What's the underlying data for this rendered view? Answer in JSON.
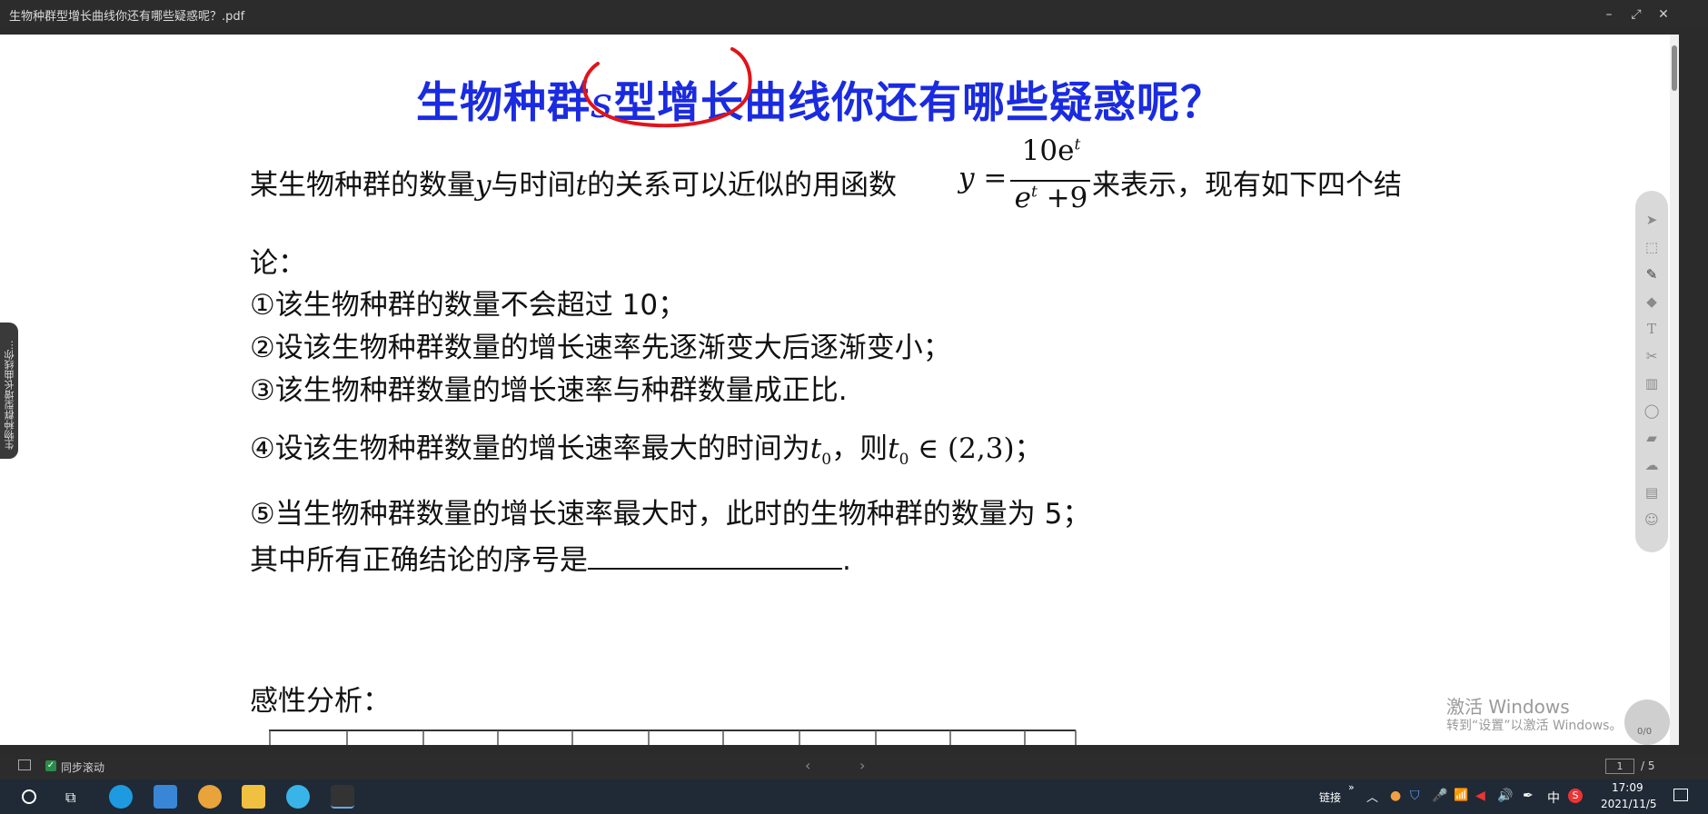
{
  "window": {
    "title": "生物种群型增长曲线你还有哪些疑惑呢？.pdf",
    "controls": {
      "minimize": "–",
      "restore": "⤢",
      "close": "✕"
    }
  },
  "document": {
    "title_part1": "生物种群",
    "title_var": "s",
    "title_part2": "型增长曲线你还有哪些疑惑呢？",
    "line1_a": "某生物种群的数量",
    "var_y": "y",
    "line1_b": "与时间",
    "var_t": "t",
    "line1_c": "的关系可以近似的用函数",
    "func_y": "y =",
    "frac_num": "10e",
    "frac_num_sup": "t",
    "frac_den_e": "e",
    "frac_den_sup": "t",
    "frac_den_rest": " +9",
    "line1_d": "来表示，现有如下四个结",
    "line2": "论：",
    "item1": "①该生物种群的数量不会超过 10；",
    "item2": "②设该生物种群数量的增长速率先逐渐变大后逐渐变小；",
    "item3": "③该生物种群数量的增长速率与种群数量成正比.",
    "item4_a": "④设该生物种群数量的增长速率最大的时间为",
    "t0": "t",
    "sub0": "0",
    "item4_b": "，则",
    "item4_c": " ∈ (2,3)；",
    "item5": "⑤当生物种群数量的增长速率最大时，此时的生物种群的数量为 5；",
    "question": "其中所有正确结论的序号是",
    "question_end": ".",
    "analysis": "感性分析："
  },
  "side_tab": {
    "label": "生物种群型增长曲线你..."
  },
  "watermark": {
    "line1": "激活 Windows",
    "line2": "转到“设置”以激活 Windows。"
  },
  "page_badge": "0/0",
  "bottom_bar": {
    "sync_label": "同步滚动",
    "sync_checked": true,
    "page_current": "1",
    "page_total": "/ 5"
  },
  "taskbar": {
    "link_label": "链接",
    "ime": "中",
    "time": "17:09",
    "date": "2021/11/5"
  },
  "colors": {
    "title_blue": "#1a2be0",
    "annotation_red": "#e0141a"
  }
}
